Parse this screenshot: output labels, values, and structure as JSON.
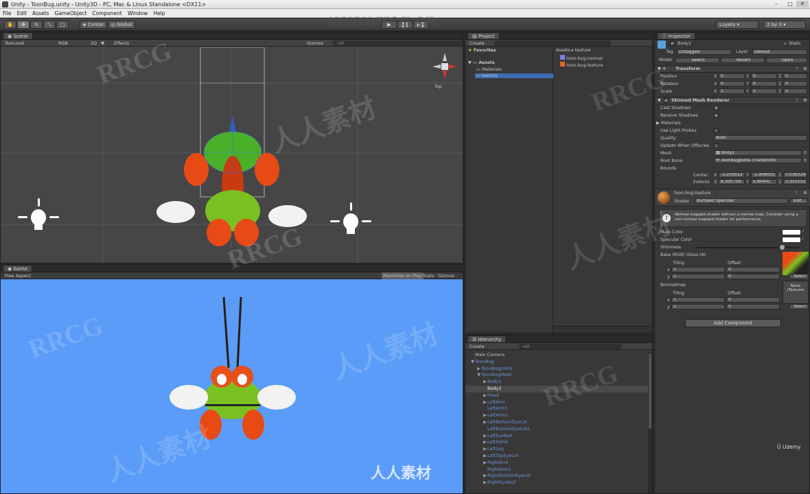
{
  "window": {
    "title": "Unity - ToonBug.unity - Unity3D - PC, Mac & Linux Standalone <DX11>",
    "minimize": "–",
    "maximize": "□",
    "close": "✕"
  },
  "menu": [
    "File",
    "Edit",
    "Assets",
    "GameObject",
    "Component",
    "Window",
    "Help"
  ],
  "toolbar": {
    "pivot": "Center",
    "space": "Global",
    "layers": "Layers",
    "layout": "2 by 3",
    "tools": [
      "hand-icon",
      "move-icon",
      "rotate-icon",
      "scale-icon",
      "rect-icon"
    ]
  },
  "scene": {
    "tab": "Scene",
    "shading": "Textured",
    "render": "RGB",
    "mode2d": "2D",
    "effects": "Effects",
    "gizmos": "Gizmos",
    "search": "All",
    "view_label": "Top"
  },
  "game": {
    "tab": "Game",
    "aspect": "Free Aspect",
    "maximize": "Maximize on Play",
    "stats": "Stats",
    "gizmos": "Gizmos"
  },
  "project": {
    "tab": "Project",
    "create": "Create",
    "favorites": "Favorites",
    "assets": "Assets",
    "folders": [
      "Materials",
      "texture"
    ],
    "breadcrumb": "Assets ▸ texture",
    "files": [
      "toon-bug-normal",
      "toon-bug-texture"
    ]
  },
  "hierarchy": {
    "tab": "Hierarchy",
    "create": "Create",
    "search": "All",
    "items": [
      {
        "label": "Main Camera",
        "indent": 0,
        "arrow": "",
        "style": "plain"
      },
      {
        "label": "ToonBug",
        "indent": 0,
        "arrow": "▼",
        "style": "blue"
      },
      {
        "label": "ToonBugJoints",
        "indent": 1,
        "arrow": "▶",
        "style": "blue"
      },
      {
        "label": "ToonBugMesh",
        "indent": 1,
        "arrow": "▼",
        "style": "blue"
      },
      {
        "label": "Body1",
        "indent": 2,
        "arrow": "▶",
        "style": "blue"
      },
      {
        "label": "Body2",
        "indent": 2,
        "arrow": "",
        "style": "selected"
      },
      {
        "label": "Head",
        "indent": 2,
        "arrow": "▶",
        "style": "blue"
      },
      {
        "label": "LeftArm",
        "indent": 2,
        "arrow": "▶",
        "style": "blue"
      },
      {
        "label": "LeftArm1",
        "indent": 2,
        "arrow": "",
        "style": "blue"
      },
      {
        "label": "LeftArm2",
        "indent": 2,
        "arrow": "▶",
        "style": "blue"
      },
      {
        "label": "LeftBottomEyeLid",
        "indent": 2,
        "arrow": "▶",
        "style": "blue"
      },
      {
        "label": "LeftBottomEyeLid1",
        "indent": 2,
        "arrow": "",
        "style": "blue"
      },
      {
        "label": "LeftEyeBall",
        "indent": 2,
        "arrow": "▶",
        "style": "blue"
      },
      {
        "label": "LeftHand",
        "indent": 2,
        "arrow": "▶",
        "style": "blue"
      },
      {
        "label": "LeftLeg",
        "indent": 2,
        "arrow": "▶",
        "style": "blue"
      },
      {
        "label": "LeftTopEyeLid",
        "indent": 2,
        "arrow": "▶",
        "style": "blue"
      },
      {
        "label": "RightArm",
        "indent": 2,
        "arrow": "▶",
        "style": "blue"
      },
      {
        "label": "RightArm1",
        "indent": 2,
        "arrow": "",
        "style": "blue"
      },
      {
        "label": "RightBottomEyeLid",
        "indent": 2,
        "arrow": "▶",
        "style": "blue"
      },
      {
        "label": "RightEyeBall",
        "indent": 2,
        "arrow": "▶",
        "style": "blue"
      }
    ]
  },
  "inspector": {
    "tab": "Inspector",
    "object_name": "Body2",
    "static": "Static",
    "tag_label": "Tag",
    "tag": "Untagged",
    "layer_label": "Layer",
    "layer": "Default",
    "model_label": "Model",
    "select": "Select",
    "revert": "Revert",
    "open": "Open",
    "transform": {
      "title": "Transform",
      "rows": [
        {
          "label": "Position",
          "x": "0",
          "y": "0",
          "z": "0"
        },
        {
          "label": "Rotation",
          "x": "0",
          "y": "0",
          "z": "0"
        },
        {
          "label": "Scale",
          "x": "1",
          "y": "1",
          "z": "1"
        }
      ]
    },
    "smr": {
      "title": "Skinned Mesh Renderer",
      "cast_shadows": "Cast Shadows",
      "receive_shadows": "Receive Shadows",
      "materials": "Materials",
      "use_light_probes": "Use Light Probes",
      "quality_label": "Quality",
      "quality": "Auto",
      "update_offscreen": "Update When Offscree",
      "mesh_label": "Mesh",
      "mesh": "Body2",
      "root_bone_label": "Root Bone",
      "root_bone": "ToonBugJoints (Transform)",
      "bounds": "Bounds",
      "center_label": "Center",
      "center": [
        "-3.250012",
        "-1.908031",
        "0.039329"
      ],
      "extents_label": "Extents",
      "extents": [
        "6.305756",
        "5.80441",
        "3.352152"
      ]
    },
    "material": {
      "name": "toon-bug-texture",
      "shader_label": "Shader",
      "shader": "Bumped Specular",
      "edit": "Edit...",
      "warning": "Normal mapped shader without a normal map. Consider using a non-normal mapped shader for performance.",
      "main_color": "Main Color",
      "specular_color": "Specular Color",
      "shininess": "Shininess",
      "base": "Base (RGB) Gloss (A)",
      "tiling": "Tiling",
      "offset": "Offset",
      "normalmap": "Normalmap",
      "none_texture": "None (Texture)",
      "select": "Select",
      "x": "x",
      "y": "y",
      "tile_x": "1",
      "tile_y": "1",
      "off_x": "0",
      "off_y": "0"
    },
    "add_component": "Add Component"
  },
  "branding": {
    "udemy": "Udemy",
    "watermark_cn": "人人素材",
    "watermark_en": "RRCG",
    "site": "www.rrcg.cn"
  },
  "colors": {
    "game_bg": "#5a9cf8",
    "scene_bg": "#4a4a4a",
    "selection": "#3d6db5",
    "accent_blue": "#6a94d8"
  }
}
